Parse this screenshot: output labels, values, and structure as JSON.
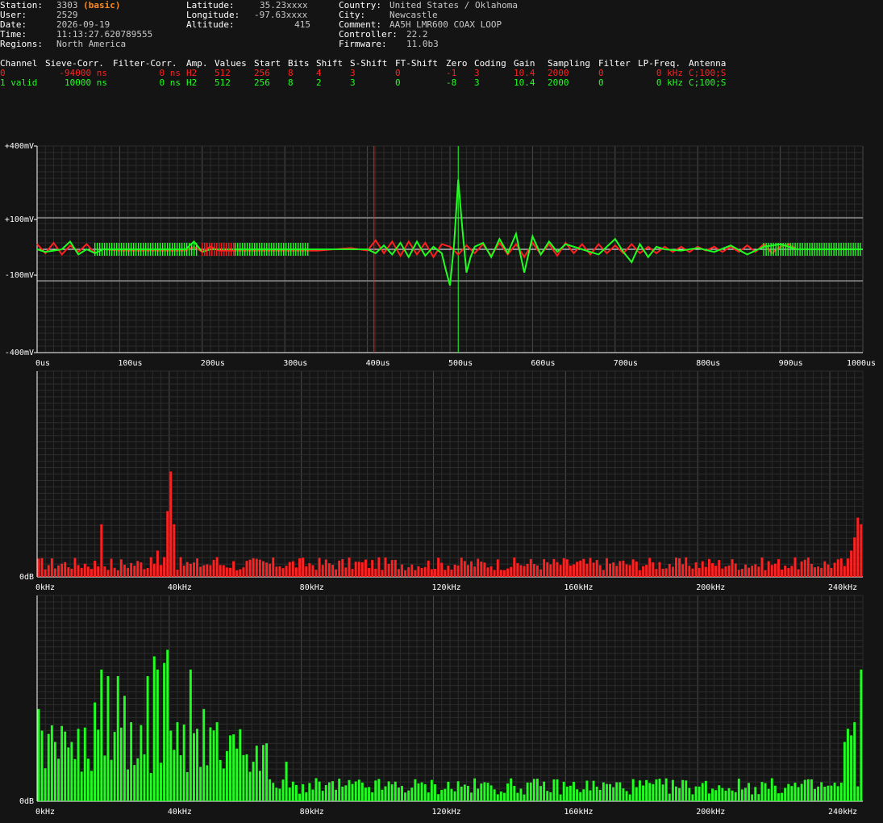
{
  "station_info": {
    "station_label": "Station:",
    "station": "3303",
    "station_tag": "(basic)",
    "user_label": "User:",
    "user": "2529",
    "date_label": "Date:",
    "date": "2026-09-19",
    "time_label": "Time:",
    "time": "11:13:27.620789555",
    "regions_label": "Regions:",
    "regions": "North America",
    "latitude_label": "Latitude:",
    "latitude": "35.23xxxx",
    "longitude_label": "Longitude:",
    "longitude": "-97.63xxxx",
    "altitude_label": "Altitude:",
    "altitude": "415",
    "country_label": "Country:",
    "country": "United States / Oklahoma",
    "city_label": "City:",
    "city": "Newcastle",
    "comment_label": "Comment:",
    "comment": "AA5H LMR600 COAX LOOP",
    "controller_label": "Controller:",
    "controller": "22.2",
    "firmware_label": "Firmware:",
    "firmware": "11.0b3"
  },
  "channel_table": {
    "headers": [
      "Channel",
      "Sieve-Corr.",
      "Filter-Corr.",
      "Amp.",
      "Values",
      "Start",
      "Bits",
      "Shift",
      "S-Shift",
      "FT-Shift",
      "Zero",
      "Coding",
      "Gain",
      "Sampling",
      "Filter",
      "LP-Freq.",
      "Antenna"
    ],
    "rows": [
      {
        "color": "#ff2020",
        "cells": [
          "0",
          "-94000 ns",
          "0 ns",
          "H2",
          "512",
          "256",
          "8",
          "4",
          "3",
          "0",
          "-1",
          "3",
          "10.4",
          "2000",
          "0",
          "0 kHz",
          "C;100;S"
        ]
      },
      {
        "color": "#20ff20",
        "cells": [
          "1 valid",
          "10000 ns",
          "0 ns",
          "H2",
          "512",
          "256",
          "8",
          "2",
          "3",
          "0",
          "-8",
          "3",
          "10.4",
          "2000",
          "0",
          "0 kHz",
          "C;100;S"
        ]
      }
    ]
  },
  "colors": {
    "background": "#141414",
    "channel0": "#ff2020",
    "channel1": "#20ff20",
    "grid": "#3a3a3a",
    "axis": "#ffffff"
  },
  "chart_data": [
    {
      "type": "line",
      "x_unit": "us",
      "xlim": [
        0,
        1000
      ],
      "ylim": [
        -400,
        400
      ],
      "y_ticks": [
        "+400mV",
        "+100mV",
        "-100mV",
        "-400mV"
      ],
      "y_tick_values": [
        400,
        100,
        -100,
        -400
      ],
      "x_ticks": [
        "0us",
        "100us",
        "200us",
        "300us",
        "400us",
        "500us",
        "600us",
        "700us",
        "800us",
        "900us",
        "1000us"
      ],
      "x_tick_values": [
        0,
        100,
        200,
        300,
        400,
        500,
        600,
        700,
        800,
        900,
        1000
      ],
      "markers": [
        {
          "x": 408,
          "color": "#ff2020"
        },
        {
          "x": 510,
          "color": "#20ff20"
        }
      ],
      "series": [
        {
          "color": "#ff2020",
          "x": [
            0,
            10,
            20,
            30,
            40,
            50,
            60,
            70,
            80,
            100,
            120,
            140,
            160,
            180,
            190,
            200,
            210,
            220,
            240,
            260,
            280,
            300,
            320,
            340,
            360,
            380,
            400,
            410,
            420,
            430,
            440,
            450,
            460,
            470,
            480,
            490,
            500,
            510,
            520,
            530,
            540,
            550,
            560,
            570,
            580,
            590,
            600,
            610,
            620,
            630,
            640,
            650,
            660,
            670,
            680,
            690,
            700,
            710,
            720,
            730,
            740,
            750,
            760,
            770,
            780,
            790,
            800,
            810,
            820,
            830,
            840,
            850,
            860,
            870,
            880,
            890,
            900,
            910,
            920,
            950,
            980,
            1000
          ],
          "y": [
            20,
            -15,
            25,
            -20,
            15,
            -10,
            20,
            -15,
            0,
            -5,
            -5,
            -5,
            -5,
            -5,
            10,
            -10,
            10,
            -5,
            -5,
            -5,
            -5,
            -5,
            -5,
            -5,
            0,
            5,
            -5,
            35,
            -15,
            30,
            -25,
            30,
            -20,
            25,
            -30,
            20,
            10,
            -20,
            15,
            -15,
            20,
            -25,
            25,
            -20,
            20,
            -30,
            25,
            -20,
            20,
            -25,
            25,
            -15,
            20,
            -20,
            20,
            -15,
            15,
            -15,
            20,
            -15,
            10,
            -15,
            10,
            -10,
            10,
            -10,
            10,
            -5,
            10,
            -10,
            10,
            -10,
            15,
            -10,
            20,
            -15,
            10,
            20,
            0,
            0,
            0,
            0
          ]
        },
        {
          "color": "#20ff20",
          "x": [
            0,
            10,
            20,
            30,
            40,
            50,
            60,
            70,
            80,
            100,
            120,
            140,
            160,
            180,
            190,
            200,
            210,
            220,
            240,
            260,
            280,
            300,
            320,
            340,
            360,
            380,
            400,
            410,
            420,
            430,
            440,
            450,
            460,
            470,
            480,
            490,
            495,
            500,
            505,
            510,
            515,
            520,
            525,
            530,
            540,
            550,
            560,
            570,
            580,
            590,
            600,
            610,
            620,
            630,
            640,
            660,
            680,
            700,
            710,
            720,
            730,
            740,
            750,
            760,
            780,
            800,
            820,
            840,
            860,
            880,
            900,
            920,
            950,
            980,
            1000
          ],
          "y": [
            0,
            -10,
            -5,
            0,
            30,
            -20,
            0,
            -15,
            0,
            0,
            0,
            0,
            0,
            0,
            30,
            -10,
            0,
            0,
            0,
            0,
            0,
            0,
            0,
            0,
            0,
            0,
            0,
            -15,
            15,
            -20,
            25,
            -30,
            30,
            -25,
            10,
            -15,
            -80,
            -140,
            20,
            270,
            80,
            -90,
            -30,
            10,
            25,
            -30,
            40,
            -15,
            60,
            -90,
            50,
            -20,
            30,
            -10,
            20,
            0,
            -20,
            40,
            -10,
            -50,
            20,
            -30,
            10,
            0,
            -5,
            5,
            -10,
            15,
            -20,
            10,
            20,
            0,
            0,
            0,
            0
          ]
        }
      ]
    },
    {
      "type": "bar",
      "x_unit": "kHz",
      "xlim": [
        0,
        250
      ],
      "x_ticks": [
        "0kHz",
        "40kHz",
        "80kHz",
        "120kHz",
        "160kHz",
        "200kHz",
        "240kHz"
      ],
      "x_tick_values": [
        0,
        40,
        80,
        120,
        160,
        200,
        240
      ],
      "y_tick": "0dB",
      "series": [
        {
          "color": "#ff2020",
          "peaks": [
            [
              19,
              8
            ],
            [
              24,
              1
            ],
            [
              34,
              3
            ],
            [
              35,
              2
            ],
            [
              36,
              4
            ],
            [
              38,
              3
            ],
            [
              39,
              10
            ],
            [
              40,
              16
            ],
            [
              41,
              8
            ],
            [
              46,
              2
            ],
            [
              54,
              3
            ],
            [
              60,
              1
            ],
            [
              246,
              4
            ],
            [
              247,
              6
            ],
            [
              248,
              9
            ],
            [
              249,
              8
            ]
          ]
        }
      ]
    },
    {
      "type": "bar",
      "x_unit": "kHz",
      "xlim": [
        0,
        250
      ],
      "x_ticks": [
        "0kHz",
        "40kHz",
        "80kHz",
        "120kHz",
        "160kHz",
        "200kHz",
        "240kHz"
      ],
      "x_tick_values": [
        0,
        40,
        80,
        120,
        160,
        200,
        240
      ],
      "y_tick": "0dB",
      "series": [
        {
          "color": "#20ff20",
          "peaks": [
            [
              0,
              14
            ],
            [
              2,
              5
            ],
            [
              5,
              9
            ],
            [
              10,
              9
            ],
            [
              12,
              11
            ],
            [
              17,
              15
            ],
            [
              19,
              20
            ],
            [
              21,
              19
            ],
            [
              24,
              19
            ],
            [
              26,
              16
            ],
            [
              28,
              12
            ],
            [
              33,
              19
            ],
            [
              35,
              22
            ],
            [
              36,
              20
            ],
            [
              38,
              21
            ],
            [
              39,
              23
            ],
            [
              42,
              12
            ],
            [
              46,
              20
            ],
            [
              48,
              11
            ],
            [
              50,
              14
            ],
            [
              54,
              12
            ],
            [
              58,
              10
            ],
            [
              60,
              8
            ],
            [
              62,
              7
            ],
            [
              65,
              6
            ],
            [
              75,
              6
            ],
            [
              244,
              9
            ],
            [
              245,
              11
            ],
            [
              246,
              10
            ],
            [
              247,
              12
            ],
            [
              249,
              20
            ]
          ]
        }
      ]
    }
  ]
}
